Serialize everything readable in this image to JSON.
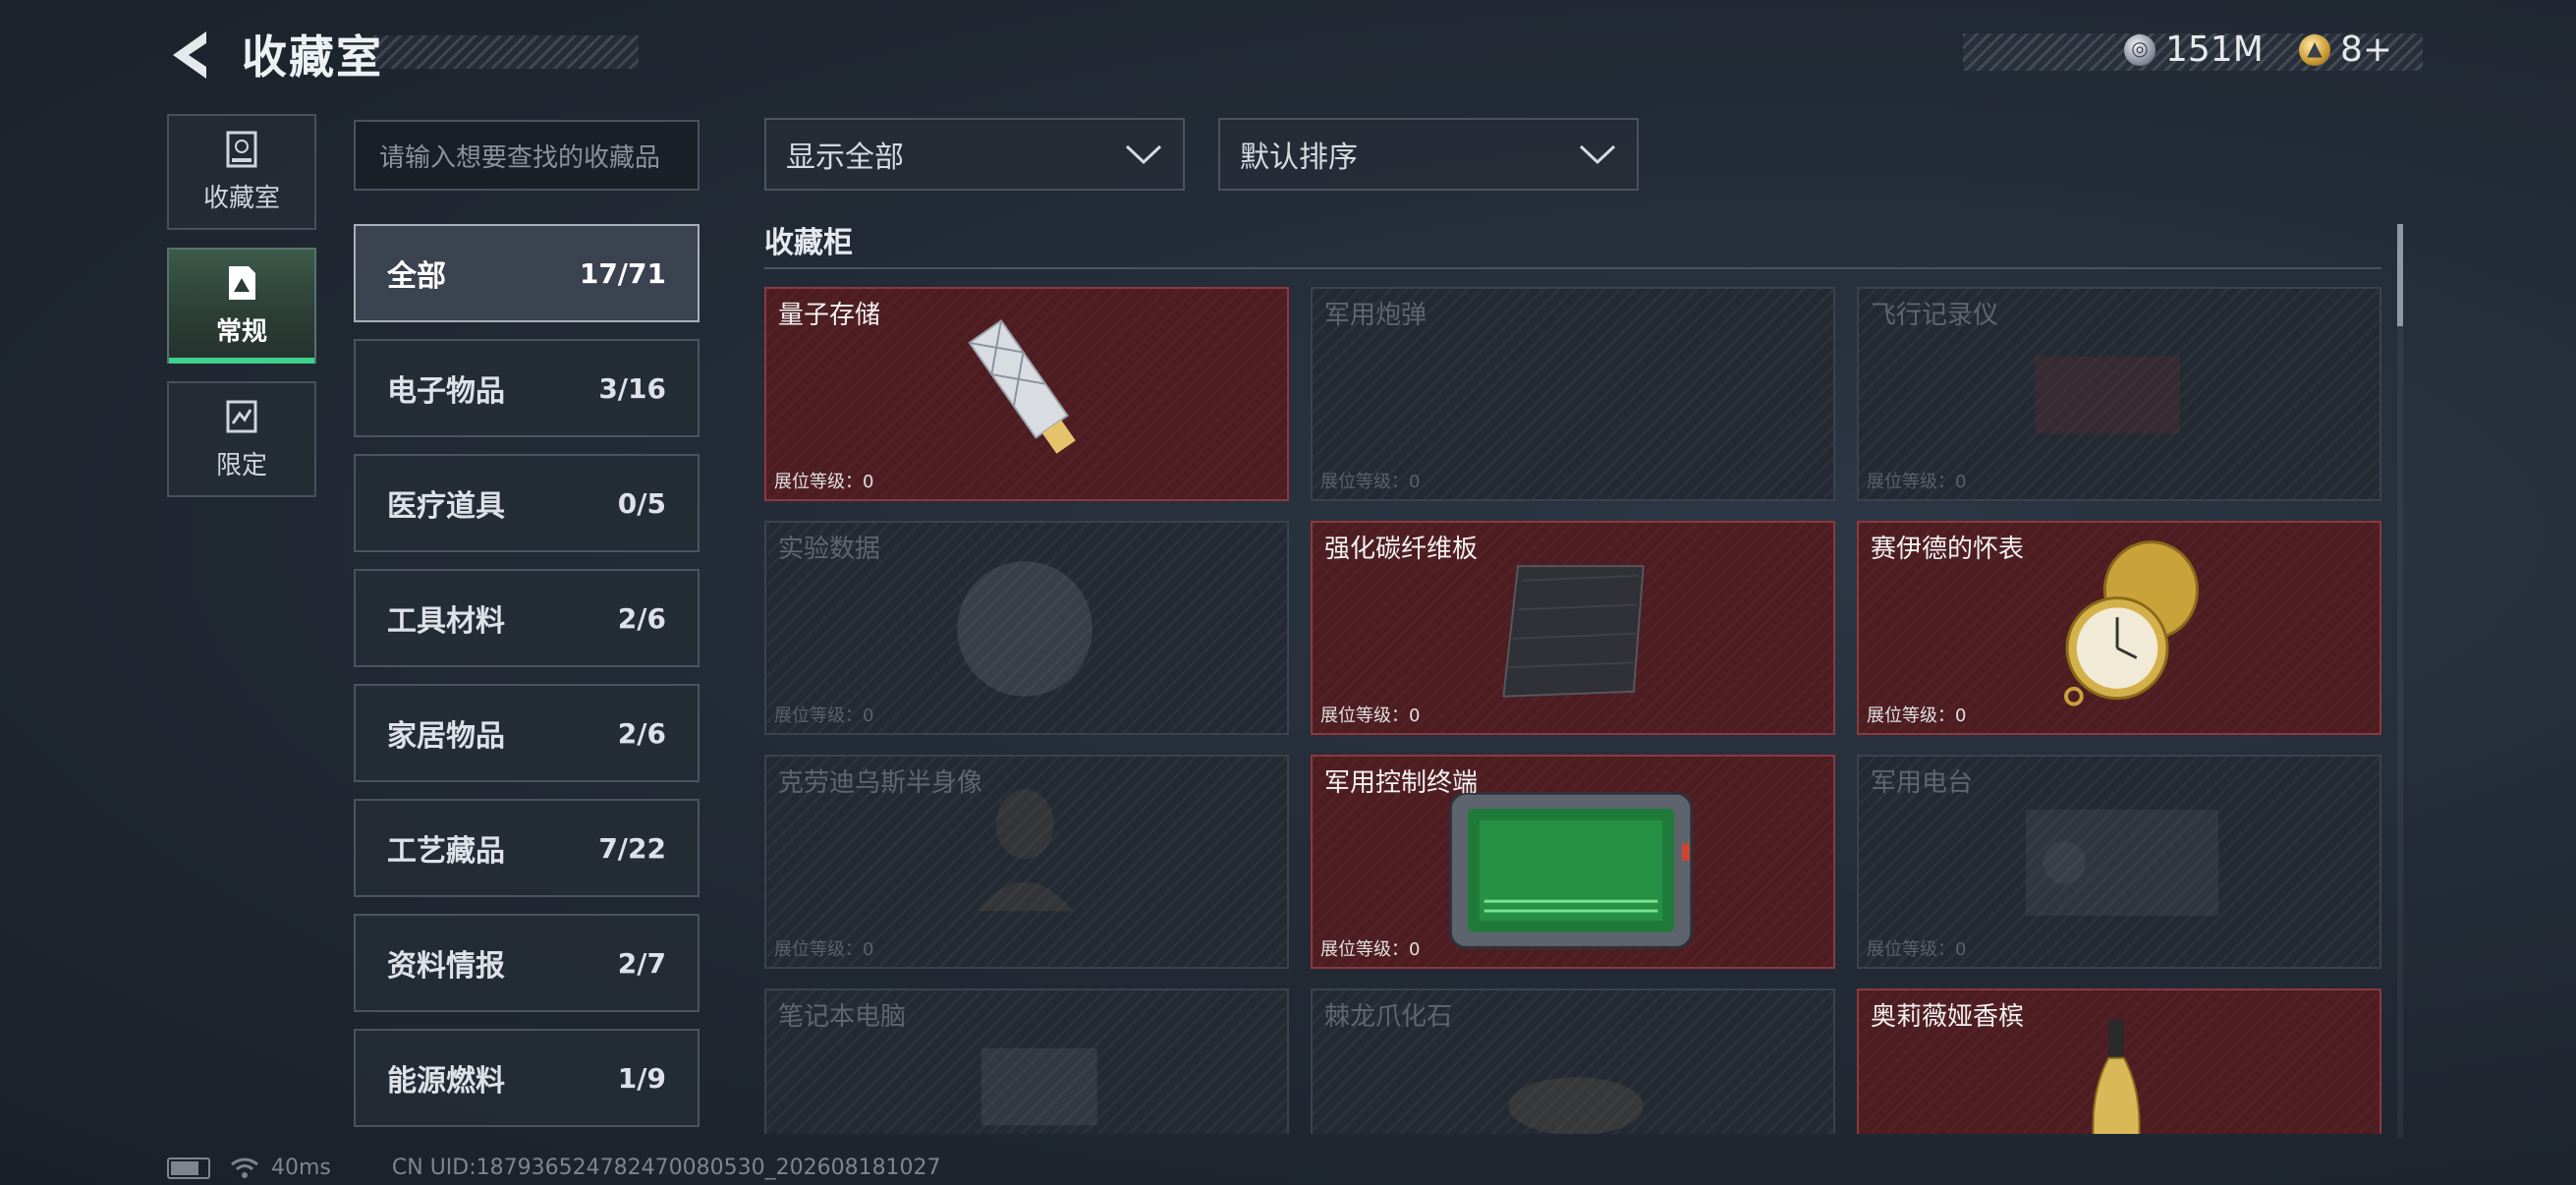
{
  "header": {
    "title": "收藏室",
    "currency_silver": "151M",
    "currency_gold": "8+",
    "coin_silver_glyph": "◎",
    "coin_gold_glyph": "▲"
  },
  "nav": [
    {
      "label": "收藏室",
      "icon": "cabinet-icon"
    },
    {
      "label": "常规",
      "icon": "document-icon"
    },
    {
      "label": "限定",
      "icon": "limited-icon"
    }
  ],
  "search": {
    "placeholder": "请输入想要查找的收藏品"
  },
  "categories": [
    {
      "label": "全部",
      "count": "17/71"
    },
    {
      "label": "电子物品",
      "count": "3/16"
    },
    {
      "label": "医疗道具",
      "count": "0/5"
    },
    {
      "label": "工具材料",
      "count": "2/6"
    },
    {
      "label": "家居物品",
      "count": "2/6"
    },
    {
      "label": "工艺藏品",
      "count": "7/22"
    },
    {
      "label": "资料情报",
      "count": "2/7"
    },
    {
      "label": "能源燃料",
      "count": "1/9"
    }
  ],
  "filters": {
    "show": "显示全部",
    "sort": "默认排序"
  },
  "cabinet": {
    "title": "收藏柜",
    "items": [
      {
        "name": "量子存储",
        "level": "展位等级：0",
        "owned": true
      },
      {
        "name": "军用炮弹",
        "level": "展位等级：0",
        "owned": false
      },
      {
        "name": "飞行记录仪",
        "level": "展位等级：0",
        "owned": false
      },
      {
        "name": "实验数据",
        "level": "展位等级：0",
        "owned": false
      },
      {
        "name": "强化碳纤维板",
        "level": "展位等级：0",
        "owned": true
      },
      {
        "name": "赛伊德的怀表",
        "level": "展位等级：0",
        "owned": true
      },
      {
        "name": "克劳迪乌斯半身像",
        "level": "展位等级：0",
        "owned": false
      },
      {
        "name": "军用控制终端",
        "level": "展位等级：0",
        "owned": true
      },
      {
        "name": "军用电台",
        "level": "展位等级：0",
        "owned": false
      },
      {
        "name": "笔记本电脑",
        "level": "",
        "owned": false
      },
      {
        "name": "棘龙爪化石",
        "level": "",
        "owned": false
      },
      {
        "name": "奥莉薇娅香槟",
        "level": "",
        "owned": true
      }
    ]
  },
  "footer": {
    "ping": "40ms",
    "uid": "CN UID:187936524782470080530_202608181027"
  },
  "colors": {
    "owned_bg": "#4e1d22",
    "accent_green": "#3fd08a"
  }
}
